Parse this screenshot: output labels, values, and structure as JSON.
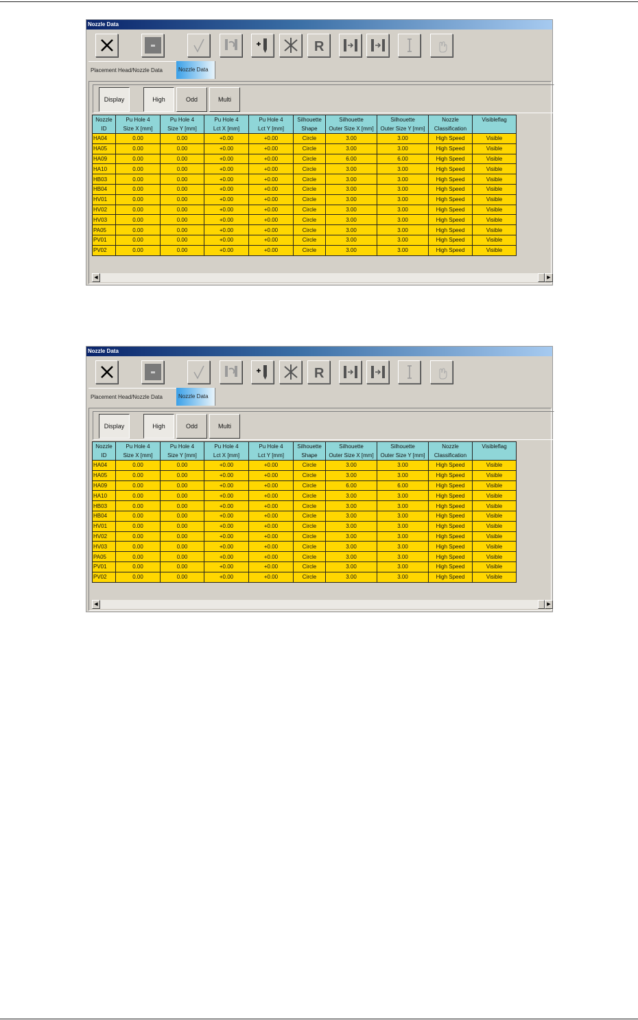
{
  "window": {
    "title": "Nozzle Data",
    "toolbar": [
      {
        "icon": "close-x-icon",
        "enabled": true
      },
      {
        "icon": "stop-square-icon",
        "enabled": true
      },
      {
        "icon": "check-icon",
        "enabled": false
      },
      {
        "icon": "nozzle-exchange-icon",
        "enabled": false
      },
      {
        "icon": "add-nozzle-icon",
        "enabled": true
      },
      {
        "icon": "asterisk-icon",
        "enabled": true
      },
      {
        "icon": "r-icon",
        "enabled": true
      },
      {
        "icon": "move-right-icon",
        "enabled": true
      },
      {
        "icon": "move-right-alt-icon",
        "enabled": true
      },
      {
        "icon": "text-cursor-icon",
        "enabled": false
      },
      {
        "icon": "hand-icon",
        "enabled": false
      }
    ],
    "tabs": [
      {
        "label": "Placement Head/Nozzle Data",
        "active": false
      },
      {
        "label": "Nozzle Data",
        "active": true
      }
    ],
    "mode_buttons": [
      {
        "label": "Display",
        "pressed": true
      },
      {
        "label": "High",
        "pressed": true
      },
      {
        "label": "Odd",
        "pressed": false
      },
      {
        "label": "Multi",
        "pressed": false
      }
    ],
    "table": {
      "columns": [
        [
          "Nozzle",
          "ID"
        ],
        [
          "Pu Hole 4",
          "Size X [mm]"
        ],
        [
          "Pu Hole 4",
          "Size Y [mm]"
        ],
        [
          "Pu Hole 4",
          "Lct X [mm]"
        ],
        [
          "Pu Hole 4",
          "Lct Y [mm]"
        ],
        [
          "Silhouette",
          "Shape"
        ],
        [
          "Silhouette",
          "Outer Size X [mm]"
        ],
        [
          "Silhouette",
          "Outer Size Y [mm]"
        ],
        [
          "Nozzle",
          "Classification"
        ],
        [
          "Visibleflag",
          ""
        ]
      ],
      "rows": [
        [
          "HA04",
          "0.00",
          "0.00",
          "+0.00",
          "+0.00",
          "Circle",
          "3.00",
          "3.00",
          "High Speed",
          "Visible"
        ],
        [
          "HA05",
          "0.00",
          "0.00",
          "+0.00",
          "+0.00",
          "Circle",
          "3.00",
          "3.00",
          "High Speed",
          "Visible"
        ],
        [
          "HA09",
          "0.00",
          "0.00",
          "+0.00",
          "+0.00",
          "Circle",
          "6.00",
          "6.00",
          "High Speed",
          "Visible"
        ],
        [
          "HA10",
          "0.00",
          "0.00",
          "+0.00",
          "+0.00",
          "Circle",
          "3.00",
          "3.00",
          "High Speed",
          "Visible"
        ],
        [
          "HB03",
          "0.00",
          "0.00",
          "+0.00",
          "+0.00",
          "Circle",
          "3.00",
          "3.00",
          "High Speed",
          "Visible"
        ],
        [
          "HB04",
          "0.00",
          "0.00",
          "+0.00",
          "+0.00",
          "Circle",
          "3.00",
          "3.00",
          "High Speed",
          "Visible"
        ],
        [
          "HV01",
          "0.00",
          "0.00",
          "+0.00",
          "+0.00",
          "Circle",
          "3.00",
          "3.00",
          "High Speed",
          "Visible"
        ],
        [
          "HV02",
          "0.00",
          "0.00",
          "+0.00",
          "+0.00",
          "Circle",
          "3.00",
          "3.00",
          "High Speed",
          "Visible"
        ],
        [
          "HV03",
          "0.00",
          "0.00",
          "+0.00",
          "+0.00",
          "Circle",
          "3.00",
          "3.00",
          "High Speed",
          "Visible"
        ],
        [
          "PA05",
          "0.00",
          "0.00",
          "+0.00",
          "+0.00",
          "Circle",
          "3.00",
          "3.00",
          "High Speed",
          "Visible"
        ],
        [
          "PV01",
          "0.00",
          "0.00",
          "+0.00",
          "+0.00",
          "Circle",
          "3.00",
          "3.00",
          "High Speed",
          "Visible"
        ],
        [
          "PV02",
          "0.00",
          "0.00",
          "+0.00",
          "+0.00",
          "Circle",
          "3.00",
          "3.00",
          "High Speed",
          "Visible"
        ]
      ]
    },
    "colors": {
      "header": "#8fd6d8",
      "cell": "#ffd700",
      "active_tab": "#3aa0e8"
    }
  }
}
